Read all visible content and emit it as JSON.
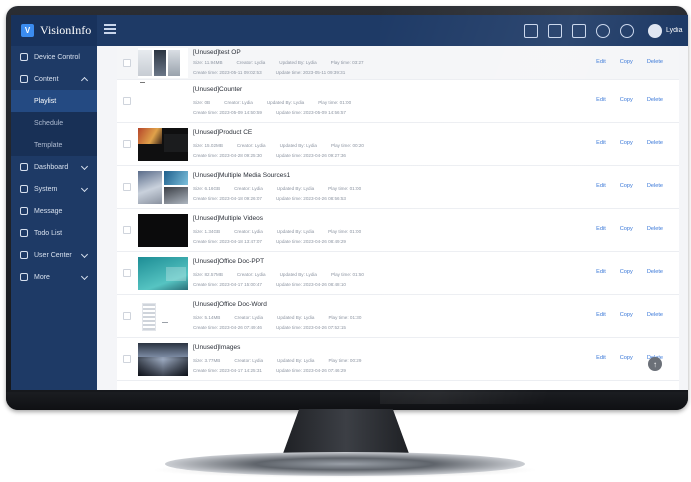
{
  "app": {
    "name": "VisionInfo",
    "logo_glyph": "V",
    "user": "Lydia"
  },
  "topbar_icons": [
    "clipboard-icon",
    "bell-icon",
    "document-icon",
    "help-icon",
    "globe-icon"
  ],
  "sidebar": {
    "items": [
      {
        "label": "Device Control",
        "icon": "monitor-icon"
      },
      {
        "label": "Content",
        "icon": "content-icon",
        "expanded": true
      },
      {
        "label": "Playlist",
        "sub": true,
        "active": true
      },
      {
        "label": "Schedule",
        "sub": true
      },
      {
        "label": "Template",
        "sub": true
      },
      {
        "label": "Dashboard",
        "icon": "dashboard-icon"
      },
      {
        "label": "System",
        "icon": "settings-icon"
      },
      {
        "label": "Message",
        "icon": "bell-icon"
      },
      {
        "label": "Todo List",
        "icon": "todo-icon"
      },
      {
        "label": "User Center",
        "icon": "user-icon"
      },
      {
        "label": "More",
        "icon": "more-icon"
      }
    ]
  },
  "labels": {
    "size": "Size:",
    "creator": "Creator:",
    "updated_by": "Updated By:",
    "play_time": "Play time:",
    "create_time": "Create time:",
    "update_time": "Update time:"
  },
  "actions": {
    "edit": "Edit",
    "copy": "Copy",
    "delete": "Delete"
  },
  "playlists": [
    {
      "name": "[Unused]test OP",
      "size": "11.94MB",
      "creator": "Lydia",
      "updated_by": "Lydia",
      "play_time": "03:27",
      "create_time": "2023-05-11 09:02:53",
      "update_time": "2023-05-11 09:39:31"
    },
    {
      "name": "[Unused]Counter",
      "size": "0B",
      "creator": "Lydia",
      "updated_by": "Lydia",
      "play_time": "01:00",
      "create_time": "2023-05-09 14:50:59",
      "update_time": "2023-05-09 14:56:57"
    },
    {
      "name": "[Unused]Product CE",
      "size": "15.02MB",
      "creator": "Lydia",
      "updated_by": "Lydia",
      "play_time": "00:20",
      "create_time": "2023-04-28 09:25:30",
      "update_time": "2023-04-26 09:27:36"
    },
    {
      "name": "[Unused]Multiple Media Sources1",
      "size": "6.16GB",
      "creator": "Lydia",
      "updated_by": "Lydia",
      "play_time": "01:00",
      "create_time": "2023-04-18 09:26:07",
      "update_time": "2023-04-26 08:56:53"
    },
    {
      "name": "[Unused]Multiple Videos",
      "size": "1.34GB",
      "creator": "Lydia",
      "updated_by": "Lydia",
      "play_time": "01:00",
      "create_time": "2023-04-18 13:47:07",
      "update_time": "2023-04-26 08:49:29"
    },
    {
      "name": "[Unused]Office Doc-PPT",
      "size": "82.57MB",
      "creator": "Lydia",
      "updated_by": "Lydia",
      "play_time": "01:50",
      "create_time": "2023-04-17 15:00:47",
      "update_time": "2023-04-26 08:48:10"
    },
    {
      "name": "[Unused]Office Doc-Word",
      "size": "5.14MB",
      "creator": "Lydia",
      "updated_by": "Lydia",
      "play_time": "01:30",
      "create_time": "2023-04-26 07:49:46",
      "update_time": "2023-04-26 07:52:15"
    },
    {
      "name": "[Unused]Images",
      "size": "3.77MB",
      "creator": "Lydia",
      "updated_by": "Lydia",
      "play_time": "00:29",
      "create_time": "2023-04-17 14:25:31",
      "update_time": "2023-04-26 07:46:29"
    }
  ]
}
